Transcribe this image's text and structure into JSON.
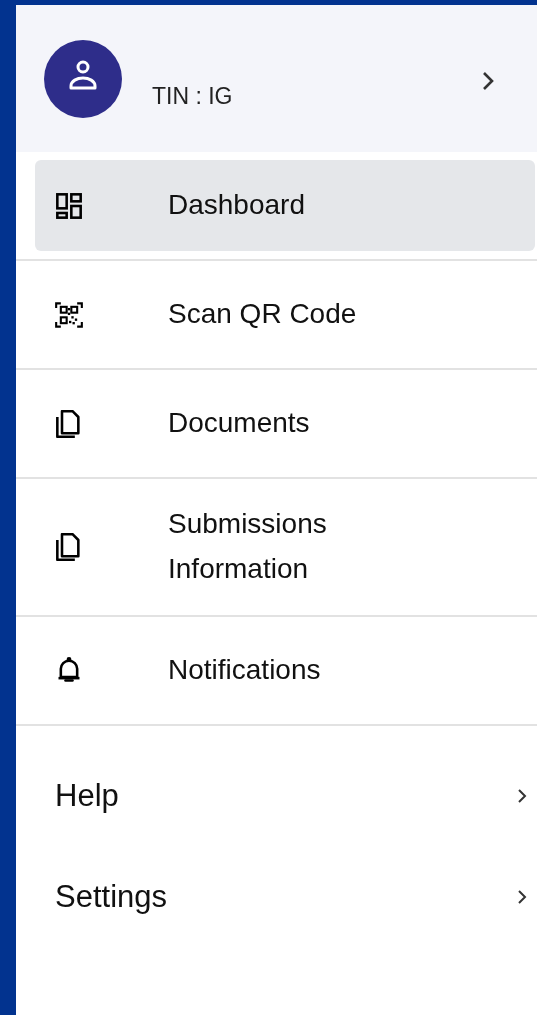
{
  "profile": {
    "tin": "TIN : IG"
  },
  "menu": [
    {
      "kind": "dashboard",
      "label": "Dashboard",
      "selected": true
    },
    {
      "kind": "qr",
      "label": "Scan QR Code",
      "selected": false
    },
    {
      "kind": "documents",
      "label": "Documents",
      "selected": false
    },
    {
      "kind": "documents",
      "label": "Submissions\nInformation",
      "selected": false
    },
    {
      "kind": "bell",
      "label": "Notifications",
      "selected": false
    }
  ],
  "links": [
    {
      "label": "Help"
    },
    {
      "label": "Settings"
    }
  ]
}
